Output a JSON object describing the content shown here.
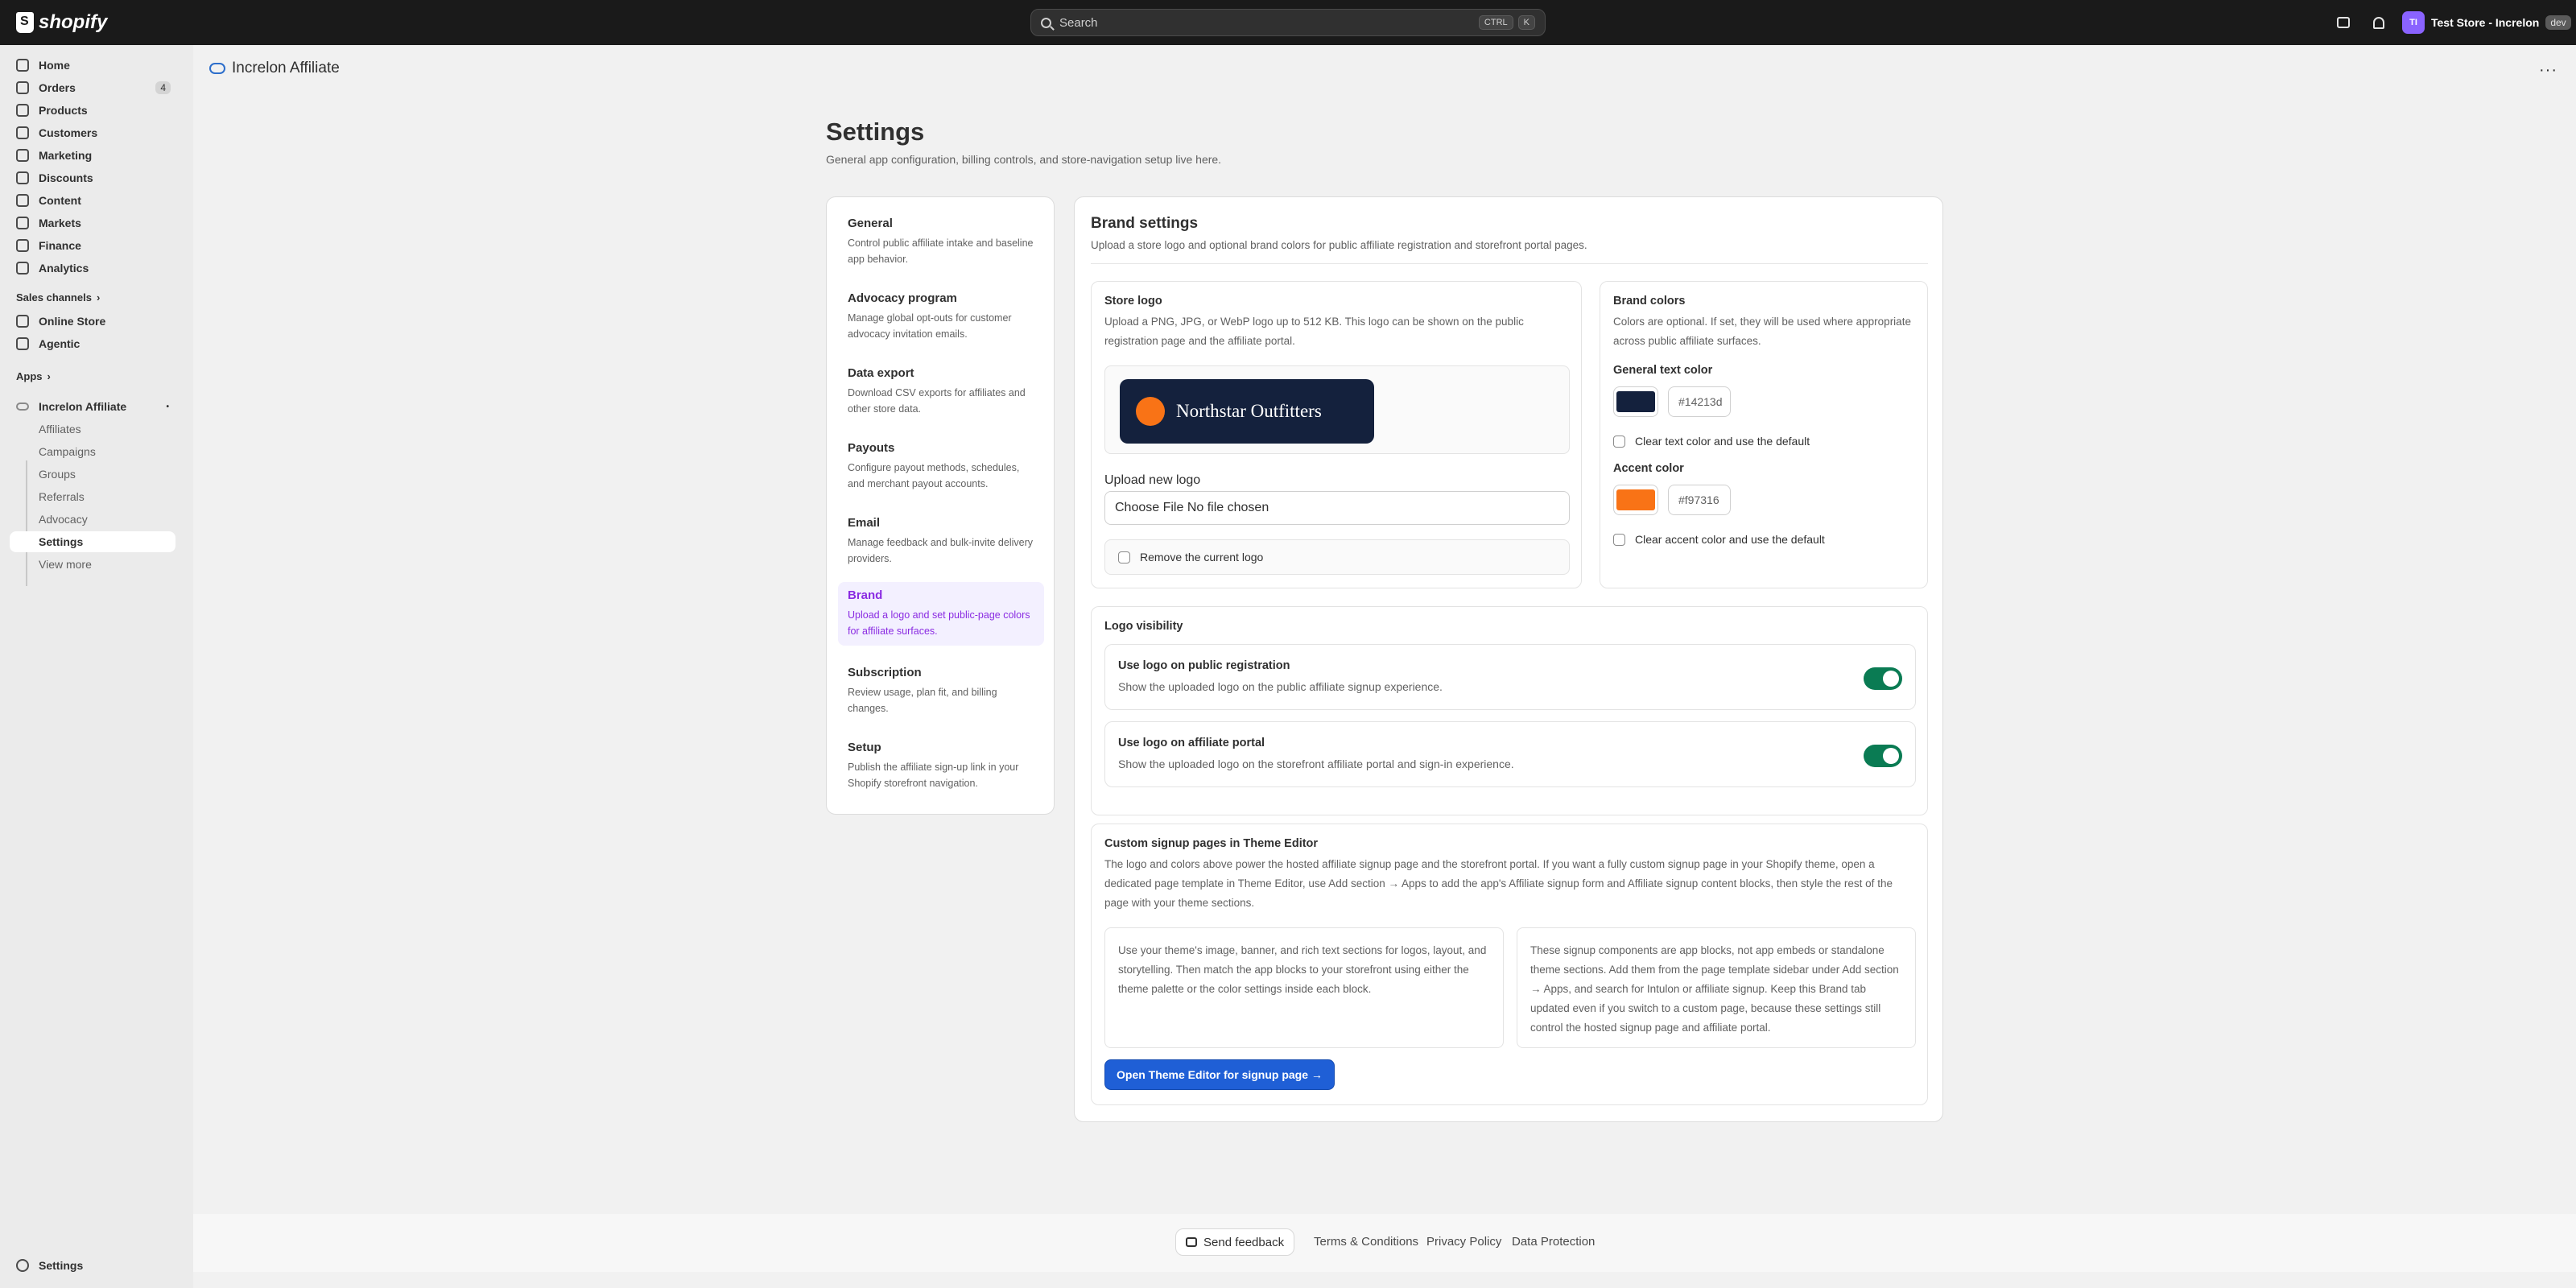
{
  "topbar": {
    "logo_text": "shopify",
    "search_placeholder": "Search",
    "shortcut_keys": [
      "CTRL",
      "K"
    ],
    "avatar_initials": "TI",
    "store_name": "Test Store - Increlon",
    "dev_badge": "dev"
  },
  "sidebar": {
    "items": [
      {
        "label": "Home",
        "icon": "home-icon"
      },
      {
        "label": "Orders",
        "icon": "orders-icon",
        "count": "4"
      },
      {
        "label": "Products",
        "icon": "tag-icon"
      },
      {
        "label": "Customers",
        "icon": "person-icon"
      },
      {
        "label": "Marketing",
        "icon": "target-icon"
      },
      {
        "label": "Discounts",
        "icon": "discount-icon"
      },
      {
        "label": "Content",
        "icon": "content-icon"
      },
      {
        "label": "Markets",
        "icon": "globe-icon"
      },
      {
        "label": "Finance",
        "icon": "bank-icon"
      },
      {
        "label": "Analytics",
        "icon": "chart-icon"
      }
    ],
    "sales_channels_heading": "Sales channels",
    "channels": [
      {
        "label": "Online Store",
        "icon": "store-icon"
      },
      {
        "label": "Agentic",
        "icon": "agentic-icon"
      }
    ],
    "apps_heading": "Apps",
    "app_name": "Increlon Affiliate",
    "app_subitems": [
      "Affiliates",
      "Campaigns",
      "Groups",
      "Referrals",
      "Advocacy",
      "Settings"
    ],
    "view_more": "View more",
    "bottom_settings": "Settings"
  },
  "app_header": {
    "title": "Increlon Affiliate"
  },
  "page": {
    "title": "Settings",
    "subtitle": "General app configuration, billing controls, and store-navigation setup live here."
  },
  "settings_nav": [
    {
      "title": "General",
      "desc": "Control public affiliate intake and baseline app behavior."
    },
    {
      "title": "Advocacy program",
      "desc": "Manage global opt-outs for customer advocacy invitation emails."
    },
    {
      "title": "Data export",
      "desc": "Download CSV exports for affiliates and other store data."
    },
    {
      "title": "Payouts",
      "desc": "Configure payout methods, schedules, and merchant payout accounts."
    },
    {
      "title": "Email",
      "desc": "Manage feedback and bulk-invite delivery providers."
    },
    {
      "title": "Brand",
      "desc": "Upload a logo and set public-page colors for affiliate surfaces.",
      "active": true
    },
    {
      "title": "Subscription",
      "desc": "Review usage, plan fit, and billing changes."
    },
    {
      "title": "Setup",
      "desc": "Publish the affiliate sign-up link in your Shopify storefront navigation."
    }
  ],
  "brand": {
    "title": "Brand settings",
    "subtitle": "Upload a store logo and optional brand colors for public affiliate registration and storefront portal pages.",
    "store_logo": {
      "title": "Store logo",
      "desc": "Upload a PNG, JPG, or WebP logo up to 512 KB. This logo can be shown on the public registration page and the affiliate portal.",
      "preview_text": "Northstar Outfitters",
      "upload_label": "Upload new logo",
      "file_input_text": "Choose File  No file chosen",
      "remove_label": "Remove the current logo"
    },
    "colors": {
      "title": "Brand colors",
      "desc": "Colors are optional. If set, they will be used where appropriate across public affiliate surfaces.",
      "text_color_label": "General text color",
      "text_color_value": "#14213d",
      "clear_text_label": "Clear text color and use the default",
      "accent_label": "Accent color",
      "accent_value": "#f97316",
      "clear_accent_label": "Clear accent color and use the default"
    },
    "visibility": {
      "title": "Logo visibility",
      "registration_title": "Use logo on public registration",
      "registration_desc": "Show the uploaded logo on the public affiliate signup experience.",
      "registration_on": true,
      "portal_title": "Use logo on affiliate portal",
      "portal_desc": "Show the uploaded logo on the storefront affiliate portal and sign-in experience.",
      "portal_on": true
    },
    "custom_pages": {
      "title": "Custom signup pages in Theme Editor",
      "desc": "The logo and colors above power the hosted affiliate signup page and the storefront portal. If you want a fully custom signup page in your Shopify theme, open a dedicated page template in Theme Editor, use Add section → Apps to add the app's Affiliate signup form and Affiliate signup content blocks, then style the rest of the page with your theme sections.",
      "left_box": "Use your theme's image, banner, and rich text sections for logos, layout, and storytelling. Then match the app blocks to your storefront using either the theme palette or the color settings inside each block.",
      "right_box": "These signup components are app blocks, not app embeds or standalone theme sections. Add them from the page template sidebar under Add section → Apps, and search for Intulon or affiliate signup. Keep this Brand tab updated even if you switch to a custom page, because these settings still control the hosted signup page and affiliate portal.",
      "button_label": "Open Theme Editor for signup page →"
    }
  },
  "footer": {
    "feedback": "Send feedback",
    "links": [
      "Terms & Conditions",
      "Privacy Policy",
      "Data Protection"
    ]
  }
}
